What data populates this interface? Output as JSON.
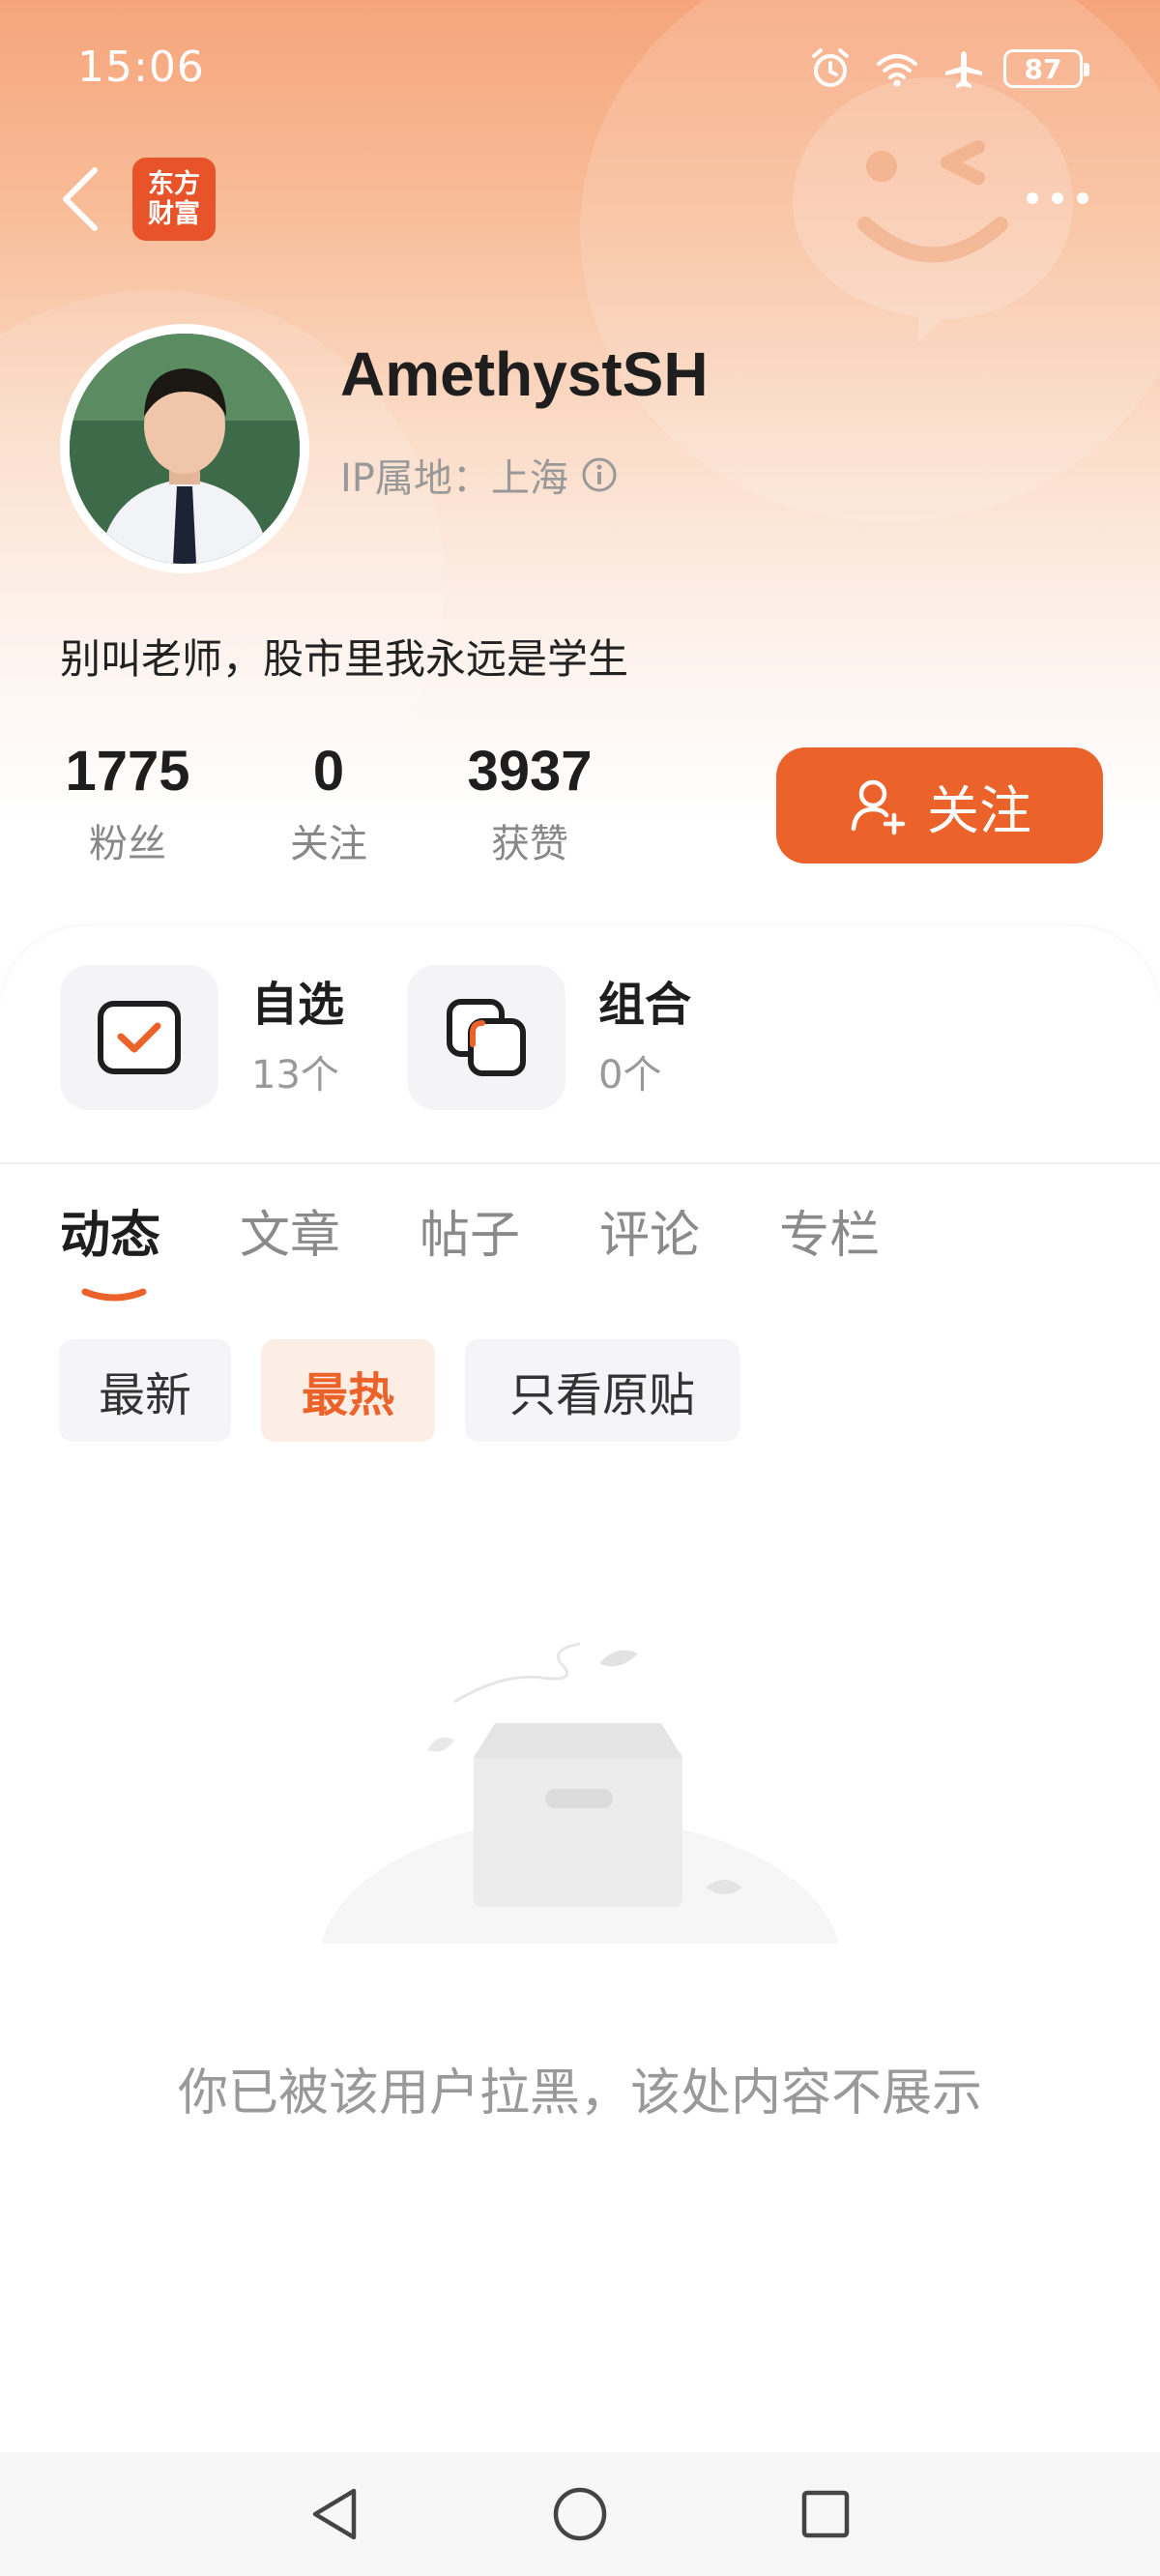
{
  "status_bar": {
    "time": "15:06",
    "battery": "87",
    "icons": [
      "alarm-icon",
      "wifi-icon",
      "airplane-mode-icon",
      "battery-icon"
    ]
  },
  "nav": {
    "back_icon": "chevron-left-icon",
    "logo_line1": "东方",
    "logo_line2": "财富",
    "more_icon": "more-horizontal-icon"
  },
  "profile": {
    "username": "AmethystSH",
    "ip_location": "IP属地：上海",
    "info_icon": "info-circle-icon",
    "bio": "别叫老师，股市里我永远是学生"
  },
  "stats": [
    {
      "value": "1775",
      "label": "粉丝"
    },
    {
      "value": "0",
      "label": "关注"
    },
    {
      "value": "3937",
      "label": "获赞"
    }
  ],
  "follow_button": {
    "label": "关注",
    "icon": "add-user-icon"
  },
  "features": [
    {
      "title": "自选",
      "count": "13个",
      "icon": "checkbox-icon"
    },
    {
      "title": "组合",
      "count": "0个",
      "icon": "portfolio-icon"
    }
  ],
  "tabs": [
    {
      "label": "动态",
      "active": true
    },
    {
      "label": "文章",
      "active": false
    },
    {
      "label": "帖子",
      "active": false
    },
    {
      "label": "评论",
      "active": false
    },
    {
      "label": "专栏",
      "active": false
    }
  ],
  "filters": [
    {
      "label": "最新",
      "active": false
    },
    {
      "label": "最热",
      "active": true
    },
    {
      "label": "只看原贴",
      "active": false
    }
  ],
  "empty_state": {
    "illustration": "empty-box-icon",
    "message": "你已被该用户拉黑，该处内容不展示"
  },
  "system_nav": [
    "back-triangle-icon",
    "home-circle-icon",
    "recents-square-icon"
  ],
  "colors": {
    "accent": "#ec622b",
    "logo": "#e8532a",
    "chip_active_bg": "#fdeee5"
  }
}
